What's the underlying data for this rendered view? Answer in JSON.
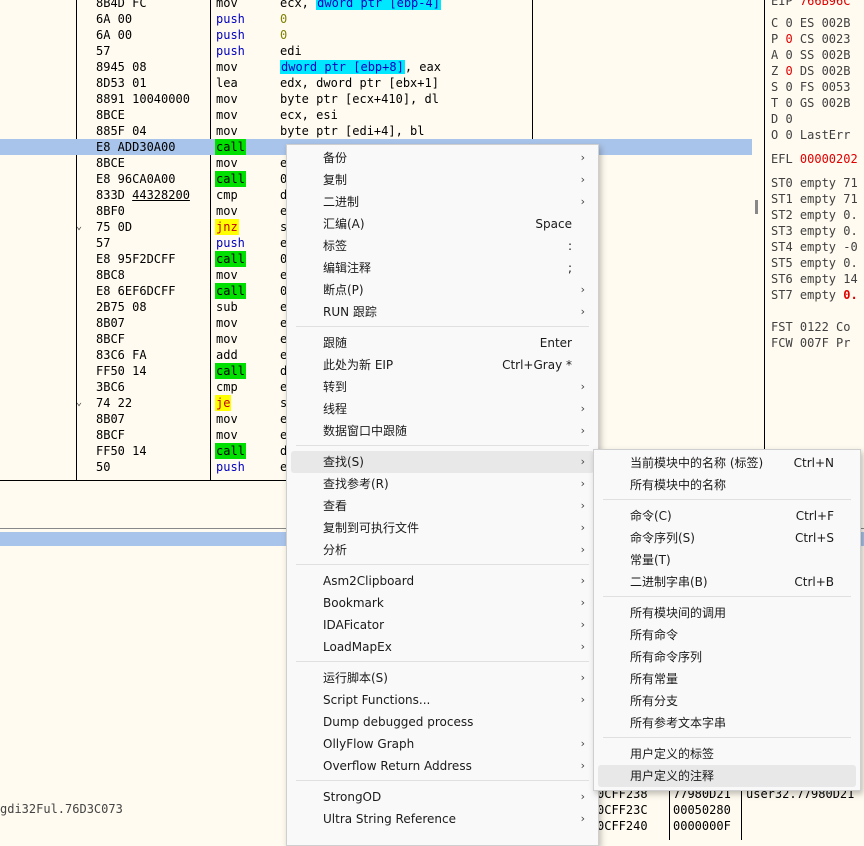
{
  "disasm": {
    "rows": [
      {
        "arrow": "",
        "hex": "8B4D FC",
        "mn": "mov",
        "mnc": "",
        "op": "ecx, dword ptr [ebp-4]",
        "opc": ""
      },
      {
        "arrow": "",
        "hex": "6A 00",
        "mn": "push",
        "mnc": "blue",
        "op": "0",
        "opc": "num"
      },
      {
        "arrow": "",
        "hex": "6A 00",
        "mn": "push",
        "mnc": "blue",
        "op": "0",
        "opc": "num"
      },
      {
        "arrow": "",
        "hex": "57",
        "mn": "push",
        "mnc": "blue",
        "op": "edi",
        "opc": ""
      },
      {
        "arrow": "",
        "hex": "8945 08",
        "mn": "mov",
        "mnc": "",
        "op": "dword ptr [ebp+8], eax",
        "opc": ""
      },
      {
        "arrow": "",
        "hex": "8D53 01",
        "mn": "lea",
        "mnc": "",
        "op": "edx, dword ptr [ebx+1]",
        "opc": ""
      },
      {
        "arrow": "",
        "hex": "8891 10040000",
        "mn": "mov",
        "mnc": "",
        "op": "byte ptr [ecx+410], dl",
        "opc": ""
      },
      {
        "arrow": "",
        "hex": "8BCE",
        "mn": "mov",
        "mnc": "",
        "op": "ecx, esi",
        "opc": ""
      },
      {
        "arrow": "",
        "hex": "885F 04",
        "mn": "mov",
        "mnc": "",
        "op": "byte ptr [edi+4], bl",
        "opc": ""
      },
      {
        "arrow": "",
        "hex": "E8 ADD30A00",
        "mn": "call",
        "mnc": "call",
        "op": "",
        "opc": ""
      },
      {
        "arrow": "",
        "hex": "8BCE",
        "mn": "mov",
        "mnc": "",
        "op": "e",
        "opc": ""
      },
      {
        "arrow": "",
        "hex": "E8 96CA0A00",
        "mn": "call",
        "mnc": "call",
        "op": "0",
        "opc": ""
      },
      {
        "arrow": "",
        "hex": "833D 44328200",
        "mn": "cmp",
        "mnc": "",
        "op": "d",
        "opc": ""
      },
      {
        "arrow": "",
        "hex": "8BF0",
        "mn": "mov",
        "mnc": "",
        "op": "e",
        "opc": ""
      },
      {
        "arrow": "⌄",
        "hex": "75 0D",
        "mn": "jnz",
        "mnc": "jmp",
        "op": "s",
        "opc": ""
      },
      {
        "arrow": "",
        "hex": "57",
        "mn": "push",
        "mnc": "blue",
        "op": "e",
        "opc": ""
      },
      {
        "arrow": "",
        "hex": "E8 95F2DCFF",
        "mn": "call",
        "mnc": "call",
        "op": "0",
        "opc": ""
      },
      {
        "arrow": "",
        "hex": "8BC8",
        "mn": "mov",
        "mnc": "",
        "op": "e",
        "opc": ""
      },
      {
        "arrow": "",
        "hex": "E8 6EF6DCFF",
        "mn": "call",
        "mnc": "call",
        "op": "0",
        "opc": ""
      },
      {
        "arrow": "",
        "hex": "2B75 08",
        "mn": "sub",
        "mnc": "",
        "op": "e",
        "opc": ""
      },
      {
        "arrow": "",
        "hex": "8B07",
        "mn": "mov",
        "mnc": "",
        "op": "e",
        "opc": ""
      },
      {
        "arrow": "",
        "hex": "8BCF",
        "mn": "mov",
        "mnc": "",
        "op": "e",
        "opc": ""
      },
      {
        "arrow": "",
        "hex": "83C6 FA",
        "mn": "add",
        "mnc": "",
        "op": "e",
        "opc": ""
      },
      {
        "arrow": "",
        "hex": "FF50 14",
        "mn": "call",
        "mnc": "call",
        "op": "d",
        "opc": ""
      },
      {
        "arrow": "",
        "hex": "3BC6",
        "mn": "cmp",
        "mnc": "",
        "op": "e",
        "opc": ""
      },
      {
        "arrow": "⌄",
        "hex": "74 22",
        "mn": "je",
        "mnc": "jmp",
        "op": "s",
        "opc": ""
      },
      {
        "arrow": "",
        "hex": "8B07",
        "mn": "mov",
        "mnc": "",
        "op": "e",
        "opc": ""
      },
      {
        "arrow": "",
        "hex": "8BCF",
        "mn": "mov",
        "mnc": "",
        "op": "e",
        "opc": ""
      },
      {
        "arrow": "",
        "hex": "FF50 14",
        "mn": "call",
        "mnc": "call",
        "op": "d",
        "opc": ""
      },
      {
        "arrow": "",
        "hex": "50",
        "mn": "push",
        "mnc": "blue",
        "op": "e",
        "opc": ""
      }
    ],
    "selected_row": 9
  },
  "regs": {
    "eip_value": "766B96C",
    "flags": [
      {
        "f": "C",
        "v": "0",
        "seg": "ES",
        "sv": "002B",
        "red": false
      },
      {
        "f": "P",
        "v": "0",
        "seg": "CS",
        "sv": "0023",
        "red": true
      },
      {
        "f": "A",
        "v": "0",
        "seg": "SS",
        "sv": "002B",
        "red": false
      },
      {
        "f": "Z",
        "v": "0",
        "seg": "DS",
        "sv": "002B",
        "red": true
      },
      {
        "f": "S",
        "v": "0",
        "seg": "FS",
        "sv": "0053",
        "red": false
      },
      {
        "f": "T",
        "v": "0",
        "seg": "GS",
        "sv": "002B",
        "red": false
      },
      {
        "f": "D",
        "v": "0",
        "seg": "",
        "sv": "",
        "red": false
      },
      {
        "f": "O",
        "v": "0",
        "seg": "LastErr",
        "sv": "",
        "red": false
      }
    ],
    "efl_label": "EFL",
    "efl_value": "00000202",
    "st": [
      {
        "n": "ST0",
        "v": "empty 71",
        "red": false
      },
      {
        "n": "ST1",
        "v": "empty 71",
        "red": false
      },
      {
        "n": "ST2",
        "v": "empty 0.",
        "red": false
      },
      {
        "n": "ST3",
        "v": "empty 0.",
        "red": false
      },
      {
        "n": "ST4",
        "v": "empty -0",
        "red": false
      },
      {
        "n": "ST5",
        "v": "empty 0.",
        "red": false
      },
      {
        "n": "ST6",
        "v": "empty 14",
        "red": false
      },
      {
        "n": "ST7",
        "v": "empty ",
        "red_v": "0.",
        "red": true
      }
    ],
    "fst": "FST 0122  Co",
    "fcw": "FCW 007F  Pr"
  },
  "bottom": {
    "addr_text": "gdi32Ful.76D3C073",
    "stack": [
      {
        "a": "0CFF238",
        "v": "77980D21",
        "c": "user32.77980D21"
      },
      {
        "a": "0CFF23C",
        "v": "00050280",
        "c": ""
      },
      {
        "a": "0CFF240",
        "v": "0000000F",
        "c": ""
      }
    ]
  },
  "menu1": {
    "groups": [
      [
        {
          "label": "备份",
          "sc": "",
          "sub": true
        },
        {
          "label": "复制",
          "sc": "",
          "sub": true
        },
        {
          "label": "二进制",
          "sc": "",
          "sub": true
        },
        {
          "label": "汇编(A)",
          "sc": "Space",
          "sub": false
        },
        {
          "label": "标签",
          "sc": ":",
          "sub": false
        },
        {
          "label": "编辑注释",
          "sc": ";",
          "sub": false
        },
        {
          "label": "断点(P)",
          "sc": "",
          "sub": true
        },
        {
          "label": "RUN 跟踪",
          "sc": "",
          "sub": true
        }
      ],
      [
        {
          "label": "跟随",
          "sc": "Enter",
          "sub": false
        },
        {
          "label": "此处为新 EIP",
          "sc": "Ctrl+Gray *",
          "sub": false
        },
        {
          "label": "转到",
          "sc": "",
          "sub": true
        },
        {
          "label": "线程",
          "sc": "",
          "sub": true
        },
        {
          "label": "数据窗口中跟随",
          "sc": "",
          "sub": true
        }
      ],
      [
        {
          "label": "查找(S)",
          "sc": "",
          "sub": true,
          "hover": true
        },
        {
          "label": "查找参考(R)",
          "sc": "",
          "sub": true
        },
        {
          "label": "查看",
          "sc": "",
          "sub": true
        },
        {
          "label": "复制到可执行文件",
          "sc": "",
          "sub": true
        },
        {
          "label": "分析",
          "sc": "",
          "sub": true
        }
      ],
      [
        {
          "label": "Asm2Clipboard",
          "sc": "",
          "sub": true
        },
        {
          "label": "Bookmark",
          "sc": "",
          "sub": true
        },
        {
          "label": "IDAFicator",
          "sc": "",
          "sub": true
        },
        {
          "label": "LoadMapEx",
          "sc": "",
          "sub": true
        }
      ],
      [
        {
          "label": "运行脚本(S)",
          "sc": "",
          "sub": true
        },
        {
          "label": "Script Functions...",
          "sc": "",
          "sub": true
        },
        {
          "label": "Dump debugged process",
          "sc": "",
          "sub": false
        },
        {
          "label": "OllyFlow Graph",
          "sc": "",
          "sub": true
        },
        {
          "label": "Overflow Return Address",
          "sc": "",
          "sub": true
        }
      ],
      [
        {
          "label": "StrongOD",
          "sc": "",
          "sub": true
        },
        {
          "label": "Ultra String Reference",
          "sc": "",
          "sub": true
        }
      ]
    ]
  },
  "menu2": {
    "groups": [
      [
        {
          "label": "当前模块中的名称 (标签)",
          "sc": "Ctrl+N"
        },
        {
          "label": "所有模块中的名称",
          "sc": ""
        }
      ],
      [
        {
          "label": "命令(C)",
          "sc": "Ctrl+F"
        },
        {
          "label": "命令序列(S)",
          "sc": "Ctrl+S"
        },
        {
          "label": "常量(T)",
          "sc": ""
        },
        {
          "label": "二进制字串(B)",
          "sc": "Ctrl+B"
        }
      ],
      [
        {
          "label": "所有模块间的调用",
          "sc": ""
        },
        {
          "label": "所有命令",
          "sc": ""
        },
        {
          "label": "所有命令序列",
          "sc": ""
        },
        {
          "label": "所有常量",
          "sc": ""
        },
        {
          "label": "所有分支",
          "sc": ""
        },
        {
          "label": "所有参考文本字串",
          "sc": ""
        }
      ],
      [
        {
          "label": "用户定义的标签",
          "sc": ""
        },
        {
          "label": "用户定义的注释",
          "sc": "",
          "hover": true
        }
      ]
    ]
  }
}
